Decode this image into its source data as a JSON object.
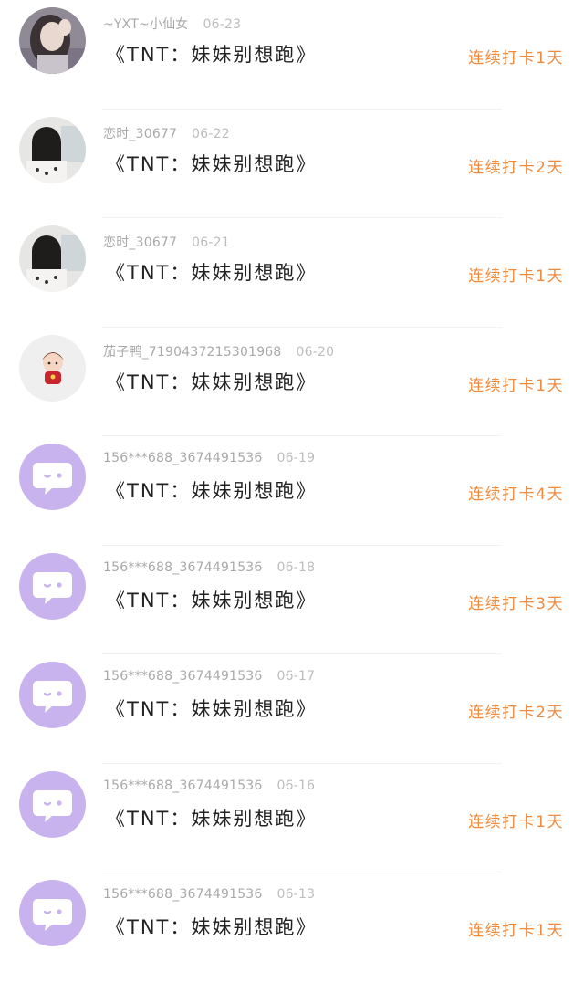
{
  "colors": {
    "streak": "#f08a3c",
    "default_avatar_bg": "#c9b3ee",
    "meta_text": "#a9a9a9",
    "title_text": "#222222"
  },
  "records": [
    {
      "user": "~YXT~小仙女",
      "date": "06-23",
      "title": "《TNT：妹妹别想跑》",
      "streak": "连续打卡1天",
      "avatar": "photo-girl-peace-sign"
    },
    {
      "user": "恋时_30677",
      "date": "06-22",
      "title": "《TNT：妹妹别想跑》",
      "streak": "连续打卡2天",
      "avatar": "photo-girl-back-view"
    },
    {
      "user": "恋时_30677",
      "date": "06-21",
      "title": "《TNT：妹妹别想跑》",
      "streak": "连续打卡1天",
      "avatar": "photo-girl-back-view"
    },
    {
      "user": "茄子鸭_7190437215301968",
      "date": "06-20",
      "title": "《TNT：妹妹别想跑》",
      "streak": "连续打卡1天",
      "avatar": "cartoon-boy"
    },
    {
      "user": "156***688_3674491536",
      "date": "06-19",
      "title": "《TNT：妹妹别想跑》",
      "streak": "连续打卡4天",
      "avatar": "default-chat-bubble"
    },
    {
      "user": "156***688_3674491536",
      "date": "06-18",
      "title": "《TNT：妹妹别想跑》",
      "streak": "连续打卡3天",
      "avatar": "default-chat-bubble"
    },
    {
      "user": "156***688_3674491536",
      "date": "06-17",
      "title": "《TNT：妹妹别想跑》",
      "streak": "连续打卡2天",
      "avatar": "default-chat-bubble"
    },
    {
      "user": "156***688_3674491536",
      "date": "06-16",
      "title": "《TNT：妹妹别想跑》",
      "streak": "连续打卡1天",
      "avatar": "default-chat-bubble"
    },
    {
      "user": "156***688_3674491536",
      "date": "06-13",
      "title": "《TNT：妹妹别想跑》",
      "streak": "连续打卡1天",
      "avatar": "default-chat-bubble"
    }
  ]
}
